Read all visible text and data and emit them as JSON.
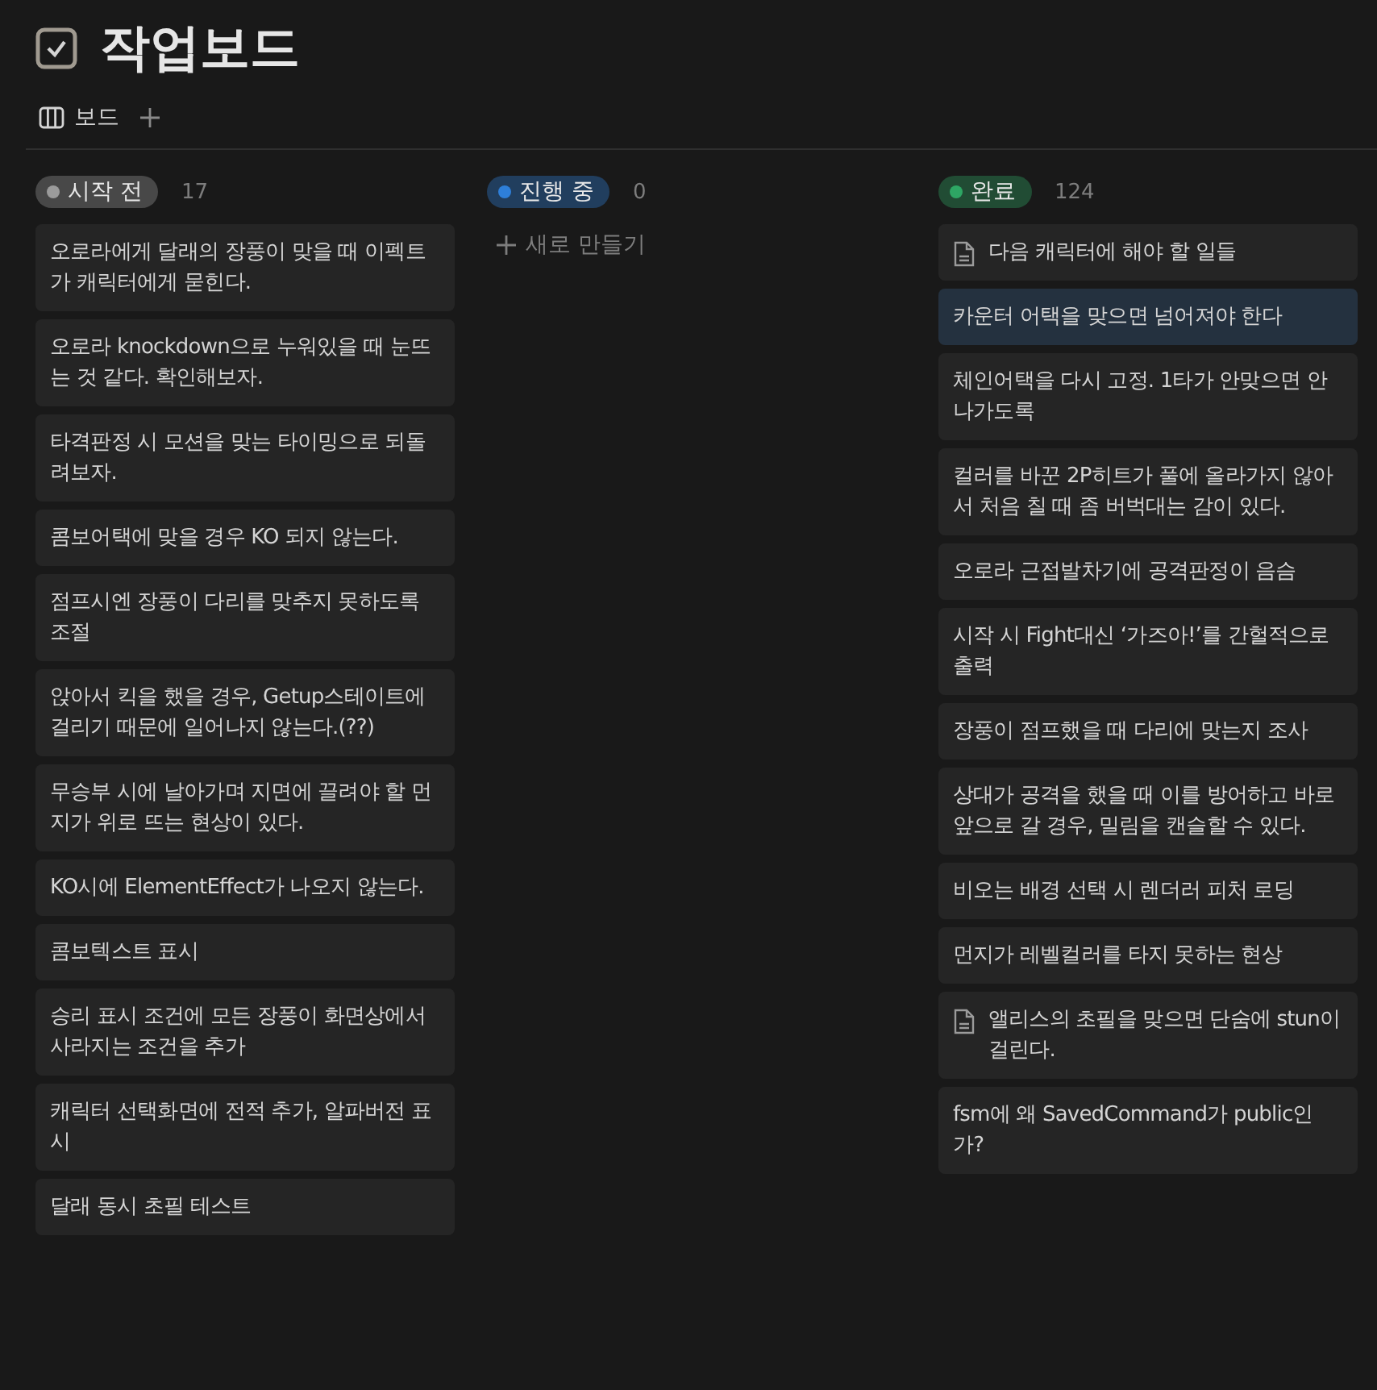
{
  "page": {
    "title": "작업보드"
  },
  "views": [
    {
      "label": "보드",
      "selected": true
    }
  ],
  "columns": [
    {
      "status": "시작 전",
      "color": "#9b9b9b",
      "count": "17",
      "cards": [
        {
          "kind": "text",
          "title": "오로라에게 달래의 장풍이 맞을 때 이펙트가 캐릭터에게 묻힌다.",
          "selected": false
        },
        {
          "kind": "text",
          "title": "오로라 knockdown으로 누워있을 때 눈뜨는 것 같다. 확인해보자.",
          "selected": false
        },
        {
          "kind": "text",
          "title": "타격판정 시 모션을 맞는 타이밍으로 되돌려보자.",
          "selected": false
        },
        {
          "kind": "text",
          "title": "콤보어택에 맞을 경우 KO 되지 않는다.",
          "selected": false
        },
        {
          "kind": "text",
          "title": "점프시엔 장풍이 다리를 맞추지 못하도록 조절",
          "selected": false
        },
        {
          "kind": "text",
          "title": "앉아서 킥을 했을 경우, Getup스테이트에 걸리기 때문에 일어나지 않는다.(??)",
          "selected": false
        },
        {
          "kind": "text",
          "title": "무승부 시에 날아가며 지면에 끌려야 할 먼지가 위로 뜨는 현상이 있다.",
          "selected": false
        },
        {
          "kind": "text",
          "title": "KO시에 ElementEffect가 나오지 않는다.",
          "selected": false
        },
        {
          "kind": "text",
          "title": "콤보텍스트 표시",
          "selected": false
        },
        {
          "kind": "text",
          "title": "승리 표시 조건에 모든 장풍이 화면상에서 사라지는 조건을 추가",
          "selected": false
        },
        {
          "kind": "text",
          "title": "캐릭터 선택화면에 전적 추가, 알파버전 표시",
          "selected": false
        },
        {
          "kind": "text",
          "title": "달래 동시 초필 테스트",
          "selected": false
        }
      ]
    },
    {
      "status": "진행 중",
      "color": "#2e7fd9",
      "count": "0",
      "new_label": "새로 만들기"
    },
    {
      "status": "완료",
      "color": "#2ea664",
      "count": "124",
      "cards": [
        {
          "kind": "page",
          "title": "다음 캐릭터에 해야 할 일들",
          "selected": false
        },
        {
          "kind": "text",
          "title": "카운터 어택을 맞으면 넘어져야 한다",
          "selected": true
        },
        {
          "kind": "text",
          "title": "체인어택을 다시 고정. 1타가 안맞으면 안나가도록",
          "selected": false
        },
        {
          "kind": "text",
          "title": "컬러를 바꾼 2P히트가 풀에 올라가지 않아서 처음 칠 때 좀 버벅대는 감이 있다.",
          "selected": false
        },
        {
          "kind": "text",
          "title": "오로라 근접발차기에 공격판정이 음슴",
          "selected": false
        },
        {
          "kind": "text",
          "title": "시작 시 Fight대신 ‘가즈아!’를 간헐적으로 출력",
          "selected": false
        },
        {
          "kind": "text",
          "title": "장풍이 점프했을 때 다리에 맞는지 조사",
          "selected": false
        },
        {
          "kind": "text",
          "title": "상대가 공격을 했을 때 이를 방어하고 바로 앞으로 갈 경우, 밀림을 캔슬할 수 있다.",
          "selected": false
        },
        {
          "kind": "text",
          "title": "비오는 배경 선택 시 렌더러 피처 로딩",
          "selected": false
        },
        {
          "kind": "text",
          "title": "먼지가 레벨컬러를 타지 못하는 현상",
          "selected": false
        },
        {
          "kind": "page",
          "title": "앨리스의 초필을 맞으면 단숨에 stun이 걸린다.",
          "selected": false
        },
        {
          "kind": "text",
          "title": "fsm에 왜 SavedCommand가 public인가?",
          "selected": false
        }
      ]
    }
  ]
}
